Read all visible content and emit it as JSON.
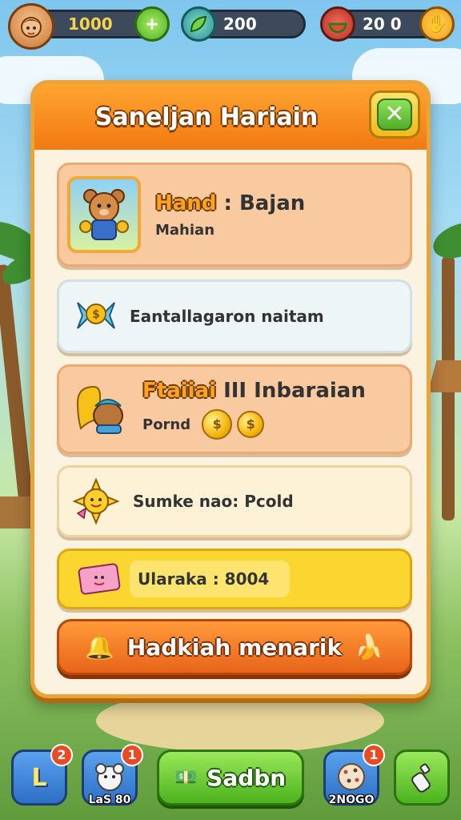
{
  "hud": {
    "coins": "1000",
    "gems": "200",
    "energy": "20 0"
  },
  "panel": {
    "title": "Saneljan Hariain",
    "close_icon": "✕",
    "cards": [
      {
        "title_part1": "Hand",
        "title_part2": ": Bajan",
        "subtitle": "Mahian"
      },
      {
        "text": "Eantallagaron naitam"
      },
      {
        "title_part1": "Ftaiiai",
        "title_part2": "III Inbaraian",
        "subtitle": "Pornd"
      },
      {
        "text": "Sumke nao: Pcold"
      },
      {
        "text": "Ularaka : 8004"
      }
    ],
    "cta_label": "Hadkiah menarik"
  },
  "bottom_nav": {
    "left_badge": "2",
    "second_badge": "1",
    "second_caption": "LaS 80",
    "main_label": "Sadbn",
    "fourth_badge": "1",
    "fourth_caption": "2NOGO"
  },
  "colors": {
    "panel_header": "#f17a12",
    "panel_border": "#e9a43a",
    "close_button": "#4fae2a",
    "cta": "#e8641a",
    "main_nav": "#4bb21e",
    "nav_blue": "#2d6fc5"
  }
}
